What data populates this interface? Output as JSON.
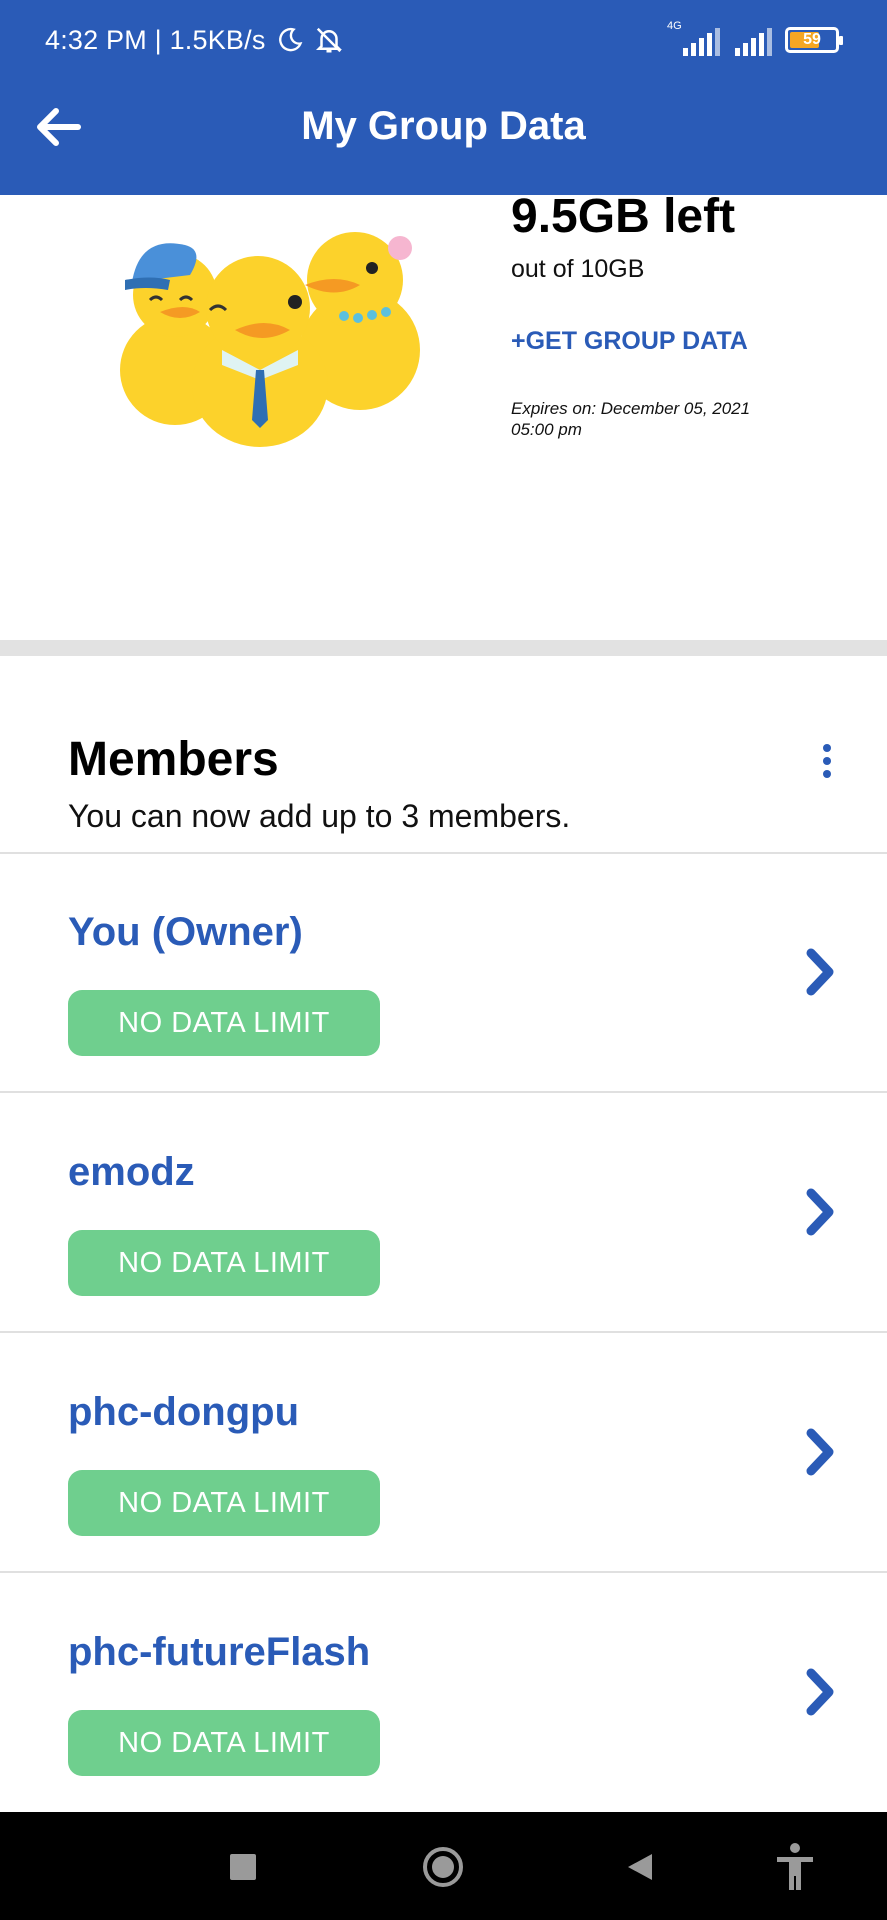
{
  "status_bar": {
    "time_speed": "4:32 PM | 1.5KB/s",
    "network": "4G",
    "battery": "59",
    "icons": [
      "moon-icon",
      "bell-off-icon",
      "signal-icon",
      "signal-icon",
      "battery-icon"
    ]
  },
  "header": {
    "title": "My Group Data",
    "back_icon": "arrow-left-icon"
  },
  "summary": {
    "data_left": "9.5GB left",
    "data_total": "out of 10GB",
    "get_data_label": "+GET GROUP DATA",
    "expires_line1": "Expires on: December 05, 2021",
    "expires_line2": "05:00 pm"
  },
  "members": {
    "title": "Members",
    "subtitle": "You can now add up to 3 members.",
    "items": [
      {
        "name": "You (Owner)",
        "limit": "NO DATA LIMIT"
      },
      {
        "name": "emodz",
        "limit": "NO DATA LIMIT"
      },
      {
        "name": "phc-dongpu",
        "limit": "NO DATA LIMIT"
      },
      {
        "name": "phc-futureFlash",
        "limit": "NO DATA LIMIT"
      }
    ]
  },
  "colors": {
    "brand_blue": "#2a5bb7",
    "badge_green": "#6fcf8e"
  },
  "nav": {
    "icons": [
      "recents-icon",
      "home-icon",
      "back-icon",
      "accessibility-icon"
    ]
  }
}
